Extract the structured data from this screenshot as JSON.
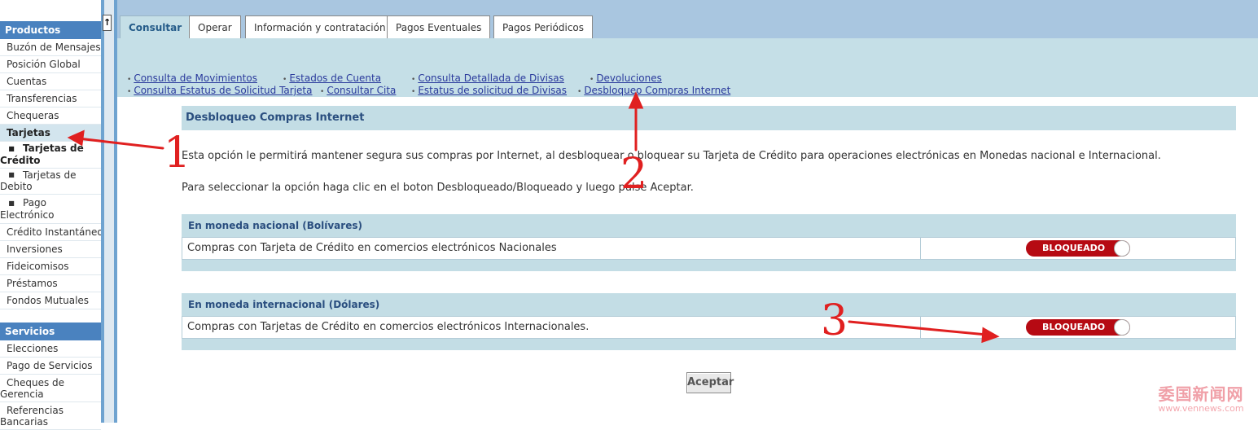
{
  "sidebar": {
    "products_header": "Productos",
    "items": [
      "Buzón de Mensajes",
      "Posición Global",
      "Cuentas",
      "Transferencias",
      "Chequeras",
      "Tarjetas"
    ],
    "tarjetas_sub": [
      {
        "line1": "Tarjetas de",
        "line2": "Crédito"
      },
      {
        "line1": "Tarjetas de",
        "line2": "Debito"
      },
      {
        "line1": "Pago Electrónico",
        "line2": ""
      }
    ],
    "items_after": [
      "Crédito Instantáneo",
      "Inversiones",
      "Fideicomisos",
      "Préstamos",
      "Fondos Mutuales"
    ],
    "services_header": "Servicios",
    "services_items": [
      {
        "line1": "Elecciones",
        "line2": ""
      },
      {
        "line1": "Pago de Servicios",
        "line2": ""
      },
      {
        "line1": "Cheques de",
        "line2": "Gerencia"
      },
      {
        "line1": "Referencias",
        "line2": "Bancarias"
      }
    ],
    "scroll_up_glyph": "↑"
  },
  "tabs": [
    "Consultar",
    "Operar",
    "Información y contratación",
    "Pagos Eventuales",
    "Pagos Periódicos"
  ],
  "subnav": {
    "consulta_movimientos": "Consulta de Movimientos",
    "estados_cuenta": "Estados de Cuenta",
    "consulta_divisas": "Consulta Detallada de Divisas",
    "devoluciones": "Devoluciones",
    "estatus_solicitud_tarjeta": "Consulta Estatus de Solicitud Tarjeta",
    "consultar_cita": "Consultar Cita",
    "estatus_divisas": "Estatus de solicitud de Divisas",
    "desbloqueo": "Desbloqueo Compras Internet",
    "bullet": "•"
  },
  "content": {
    "title": "Desbloqueo Compras Internet",
    "intro1": "Esta opción le permitirá mantener segura sus compras por Internet, al desbloquear o bloquear su Tarjeta de Crédito para operaciones electrónicas en Monedas nacional e Internacional.",
    "intro2": "Para seleccionar la opción haga clic en el boton Desbloqueado/Bloqueado y luego pulse Aceptar.",
    "panel_nacional": {
      "heading": "En moneda nacional (Bolívares)",
      "row": "Compras con Tarjeta de Crédito en comercios electrónicos Nacionales",
      "toggle": "BLOQUEADO"
    },
    "panel_internacional": {
      "heading": "En moneda internacional (Dólares)",
      "row": "Compras con Tarjetas de Crédito en comercios electrónicos Internacionales.",
      "toggle": "BLOQUEADO"
    },
    "accept": "Aceptar"
  },
  "annotations": {
    "n1": "1",
    "n2": "2",
    "n3": "3"
  },
  "watermark": {
    "cn": "委国新闻网",
    "url": "www.vennews.com"
  },
  "colors": {
    "sidebar_header": "#4a82bf",
    "subnav_bg": "#c5dfe7",
    "toggle_blocked": "#b60a13",
    "annotation_red": "#e02020"
  }
}
